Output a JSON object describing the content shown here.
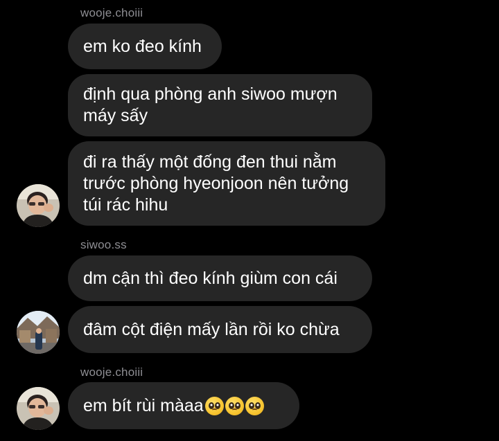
{
  "messages": [
    {
      "sender": "wooje.choiii"
    },
    {
      "text": "em ko đeo kính"
    },
    {
      "text": "định qua phòng anh siwoo mượn máy sấy"
    },
    {
      "text": "đi ra thấy một đống đen thui nằm trước phòng hyeonjoon nên tưởng túi rác hihu"
    },
    {
      "sender": "siwoo.ss"
    },
    {
      "text": "dm cận thì đeo kính giùm con cái"
    },
    {
      "text": "đâm cột điện mấy lần rồi ko chừa"
    },
    {
      "sender": "wooje.choiii"
    },
    {
      "text": "em bít rùi màaa",
      "emoji": [
        "pleading-face",
        "pleading-face",
        "pleading-face"
      ]
    }
  ],
  "colors": {
    "background": "#000000",
    "bubble": "#262626",
    "sender_label": "#8e8e93",
    "text": "#ffffff"
  }
}
